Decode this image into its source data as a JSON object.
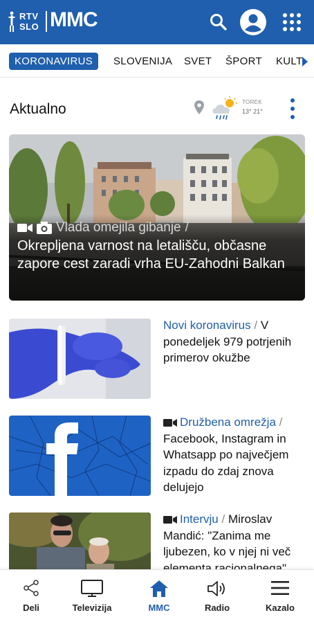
{
  "app": {
    "logo_rtv_line1": "RTV",
    "logo_rtv_line2": "SLO",
    "logo_mmc": "MMC"
  },
  "colors": {
    "brand": "#1f5fad",
    "category_link": "#1f5fad"
  },
  "header_icons": [
    "search-icon",
    "account-icon",
    "apps-grid-icon"
  ],
  "tabs": [
    {
      "label": "KORONAVIRUS",
      "active": true
    },
    {
      "label": "SLOVENIJA",
      "active": false
    },
    {
      "label": "SVET",
      "active": false
    },
    {
      "label": "ŠPORT",
      "active": false
    },
    {
      "label": "KULT",
      "active": false
    }
  ],
  "section": {
    "title": "Aktualno",
    "weather_day": "TOREK",
    "weather_temp": "13° 21°"
  },
  "hero": {
    "category": "Vlada omejila gibanje",
    "separator": "/",
    "title": "Okrepljena varnost na letališču, občasne zapore cest zaradi vrha EU-Zahodni Balkan"
  },
  "articles": [
    {
      "category": "Novi koronavirus",
      "separator": "/",
      "title": "V ponedeljek 979 potrjenih primerov okužbe",
      "video": false
    },
    {
      "category": "Družbena omrežja",
      "separator": "/",
      "title": "Facebook, Instagram in Whatsapp po največjem izpadu do zdaj znova delujejo",
      "video": true
    },
    {
      "category": "Intervju",
      "separator": "/",
      "title": "Miroslav Mandić: \"Zanima me ljubezen, ko v njej ni več elementa racionalnega\"",
      "video": true
    }
  ],
  "bottom_nav": [
    {
      "label": "Deli",
      "icon": "share-icon"
    },
    {
      "label": "Televizija",
      "icon": "tv-icon"
    },
    {
      "label": "MMC",
      "icon": "home-icon",
      "active": true
    },
    {
      "label": "Radio",
      "icon": "speaker-icon"
    },
    {
      "label": "Kazalo",
      "icon": "menu-icon"
    }
  ]
}
